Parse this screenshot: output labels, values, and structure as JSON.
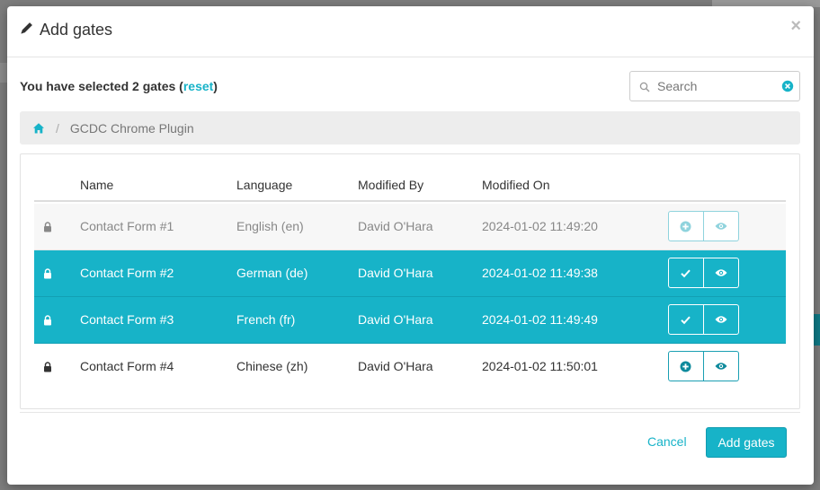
{
  "modal": {
    "title": "Add gates",
    "close_symbol": "×"
  },
  "selection": {
    "prefix": "You have selected 2 gates (",
    "reset_label": "reset",
    "suffix": ")"
  },
  "search": {
    "placeholder": "Search",
    "value": ""
  },
  "breadcrumb": {
    "separator": "/",
    "current": "GCDC Chrome Plugin"
  },
  "table": {
    "headers": {
      "name": "Name",
      "language": "Language",
      "modified_by": "Modified By",
      "modified_on": "Modified On"
    },
    "rows": [
      {
        "name": "Contact Form #1",
        "language": "English (en)",
        "modified_by": "David O'Hara",
        "modified_on": "2024-01-02 11:49:20",
        "state": "greyed",
        "action_icon": "plus-circle-icon"
      },
      {
        "name": "Contact Form #2",
        "language": "German (de)",
        "modified_by": "David O'Hara",
        "modified_on": "2024-01-02 11:49:38",
        "state": "selected",
        "action_icon": "check-icon"
      },
      {
        "name": "Contact Form #3",
        "language": "French (fr)",
        "modified_by": "David O'Hara",
        "modified_on": "2024-01-02 11:49:49",
        "state": "selected",
        "action_icon": "check-icon"
      },
      {
        "name": "Contact Form #4",
        "language": "Chinese (zh)",
        "modified_by": "David O'Hara",
        "modified_on": "2024-01-02 11:50:01",
        "state": "normal",
        "action_icon": "plus-circle-icon"
      }
    ]
  },
  "footer": {
    "cancel_label": "Cancel",
    "add_label": "Add gates"
  },
  "colors": {
    "accent": "#17b3c8",
    "selected_row": "#17b3c8",
    "backdrop": "#7d7d7d"
  }
}
